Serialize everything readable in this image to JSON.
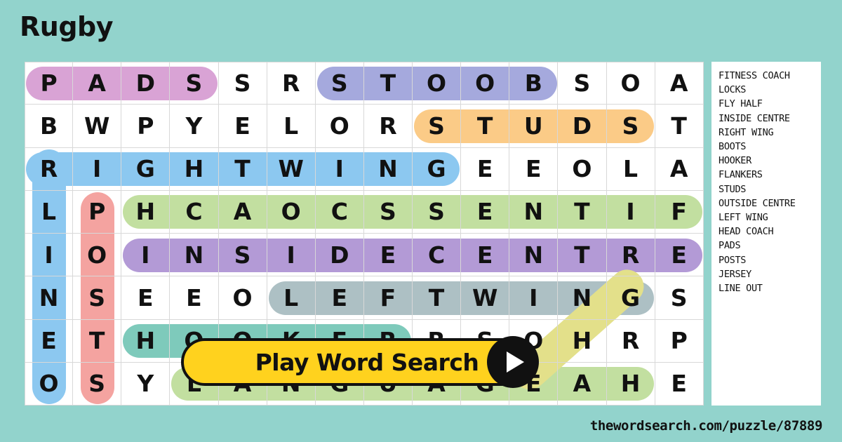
{
  "title": "Rugby",
  "footer_url": "thewordsearch.com/puzzle/87889",
  "button": {
    "label": "Play Word Search",
    "icon": "play-icon"
  },
  "colors": {
    "background": "#92d3cc",
    "panel": "#ffffff",
    "grid_line": "#d8d8d8",
    "text": "#111111",
    "button_bg": "#ffd21e",
    "pads": "#d9a3d5",
    "boots": "#a5a9dd",
    "studs": "#fbcb87",
    "right_wing": "#8cc8f0",
    "line_out": "#8cc8f0",
    "posts": "#f4a3a0",
    "fitness_coach": "#c2dfa0",
    "inside_centre": "#b39ad6",
    "left_wing": "#adc0c4",
    "jersey": "#e3e08a",
    "hooker": "#7ecabb",
    "head_coach": "#c2dfa0"
  },
  "word_list": [
    "FITNESS COACH",
    "LOCKS",
    "FLY HALF",
    "INSIDE CENTRE",
    "RIGHT WING",
    "BOOTS",
    "HOOKER",
    "FLANKERS",
    "STUDS",
    "OUTSIDE CENTRE",
    "LEFT WING",
    "HEAD COACH",
    "PADS",
    "POSTS",
    "JERSEY",
    "LINE OUT"
  ],
  "grid": {
    "rows": 8,
    "cols": 14,
    "letters": [
      [
        "P",
        "A",
        "D",
        "S",
        "S",
        "R",
        "S",
        "T",
        "O",
        "O",
        "B",
        "S",
        "O",
        "A"
      ],
      [
        "B",
        "W",
        "P",
        "Y",
        "E",
        "L",
        "O",
        "R",
        "S",
        "T",
        "U",
        "D",
        "S",
        "T"
      ],
      [
        "R",
        "I",
        "G",
        "H",
        "T",
        "W",
        "I",
        "N",
        "G",
        "E",
        "E",
        "O",
        "L",
        "A"
      ],
      [
        "L",
        "P",
        "H",
        "C",
        "A",
        "O",
        "C",
        "S",
        "S",
        "E",
        "N",
        "T",
        "I",
        "F"
      ],
      [
        "I",
        "O",
        "I",
        "N",
        "S",
        "I",
        "D",
        "E",
        "C",
        "E",
        "N",
        "T",
        "R",
        "E"
      ],
      [
        "N",
        "S",
        "E",
        "E",
        "O",
        "L",
        "E",
        "F",
        "T",
        "W",
        "I",
        "N",
        "G",
        "S"
      ],
      [
        "E",
        "T",
        "H",
        "O",
        "O",
        "K",
        "E",
        "R",
        "R",
        "S",
        "O",
        "H",
        "R",
        "P"
      ],
      [
        "O",
        "S",
        "Y",
        "L",
        "A",
        "N",
        "G",
        "U",
        "A",
        "G",
        "E",
        "A",
        "H",
        "E"
      ]
    ]
  },
  "highlights": [
    {
      "word": "PADS",
      "color": "#d9a3d5",
      "row": 0,
      "col": 0,
      "len": 4,
      "dir": "h"
    },
    {
      "word": "BOOTS",
      "color": "#a5a9dd",
      "row": 0,
      "col": 6,
      "len": 5,
      "dir": "h"
    },
    {
      "word": "STUDS",
      "color": "#fbcb87",
      "row": 1,
      "col": 8,
      "len": 5,
      "dir": "h"
    },
    {
      "word": "RIGHT WING",
      "color": "#8cc8f0",
      "row": 2,
      "col": 0,
      "len": 9,
      "dir": "h"
    },
    {
      "word": "FITNESS COACH",
      "color": "#c2dfa0",
      "row": 3,
      "col": 2,
      "len": 12,
      "dir": "h"
    },
    {
      "word": "INSIDE CENTRE",
      "color": "#b39ad6",
      "row": 4,
      "col": 2,
      "len": 12,
      "dir": "h"
    },
    {
      "word": "LEFT WING",
      "color": "#adc0c4",
      "row": 5,
      "col": 5,
      "len": 8,
      "dir": "h"
    },
    {
      "word": "HOOKER",
      "color": "#7ecabb",
      "row": 6,
      "col": 2,
      "len": 6,
      "dir": "h"
    },
    {
      "word": "HEAD COACH",
      "color": "#c2dfa0",
      "row": 7,
      "col": 3,
      "len": 10,
      "dir": "h"
    },
    {
      "word": "LINE OUT",
      "color": "#8cc8f0",
      "row": 2,
      "col": 0,
      "len": 6,
      "dir": "v"
    },
    {
      "word": "POSTS",
      "color": "#f4a3a0",
      "row": 3,
      "col": 1,
      "len": 5,
      "dir": "v"
    },
    {
      "word": "JERSEY",
      "color": "#e3e08a",
      "row": 7,
      "col": 10,
      "len": 3,
      "dir": "du"
    }
  ]
}
